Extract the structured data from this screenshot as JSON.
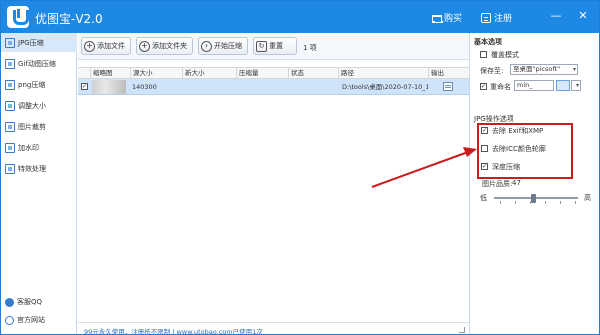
{
  "app": {
    "title": "优图宝-V2.0",
    "accent_color": "#1e88e5"
  },
  "titlebar": {
    "buy_label": "购买",
    "register_label": "注册",
    "minimize_glyph": "—",
    "close_glyph": "✕"
  },
  "sidebar": {
    "items": [
      {
        "label": "JPG压缩",
        "icon": "jpg-icon",
        "active": true
      },
      {
        "label": "Gif动图压缩",
        "icon": "gif-icon"
      },
      {
        "label": "png压缩",
        "icon": "png-icon"
      },
      {
        "label": "调整大小",
        "icon": "resize-icon"
      },
      {
        "label": "图片裁剪",
        "icon": "crop-icon"
      },
      {
        "label": "加水印",
        "icon": "watermark-icon"
      },
      {
        "label": "特效处理",
        "icon": "effects-icon"
      }
    ],
    "support_label": "客服QQ",
    "website_label": "官方网站"
  },
  "toolbar": {
    "add_file": "添加文件",
    "add_folder": "添加文件夹",
    "start_compress": "开始压缩",
    "reset": "重置",
    "count": "1 项"
  },
  "table": {
    "columns": [
      "缩略图",
      "源大小",
      "新大小",
      "压缩量",
      "状态",
      "路径",
      "输出"
    ],
    "rows": [
      {
        "checked": true,
        "source_size": "140300",
        "new_size": "",
        "ratio": "",
        "status": "",
        "path": "D:\\tools\\桌面\\2020-07-10_10..."
      }
    ]
  },
  "status_bar": {
    "text": "99元永久使用，注册抵不限制 | www.utobao.com已使用1次"
  },
  "settings": {
    "basic_title": "基本选项",
    "overwrite_label": "覆盖模式",
    "overwrite_checked": false,
    "save_to_label": "保存至:",
    "save_to_value": "至桌面\"picsoft\"",
    "rename_label": "重命名",
    "rename_checked": true,
    "rename_value": "min_",
    "jpg_title": "JPG操作选项",
    "strip_exif_label": "去除 Exif和XMP",
    "strip_exif_checked": true,
    "strip_icc_label": "去除ICC颜色轮廓",
    "strip_icc_checked": false,
    "deep_compress_label": "深度压缩",
    "deep_compress_checked": true,
    "quality_label": "图片品质:",
    "quality_value": "47",
    "quality_fraction": 0.47,
    "low_label": "低",
    "high_label": "高",
    "highlight_color": "#c81e1e"
  }
}
